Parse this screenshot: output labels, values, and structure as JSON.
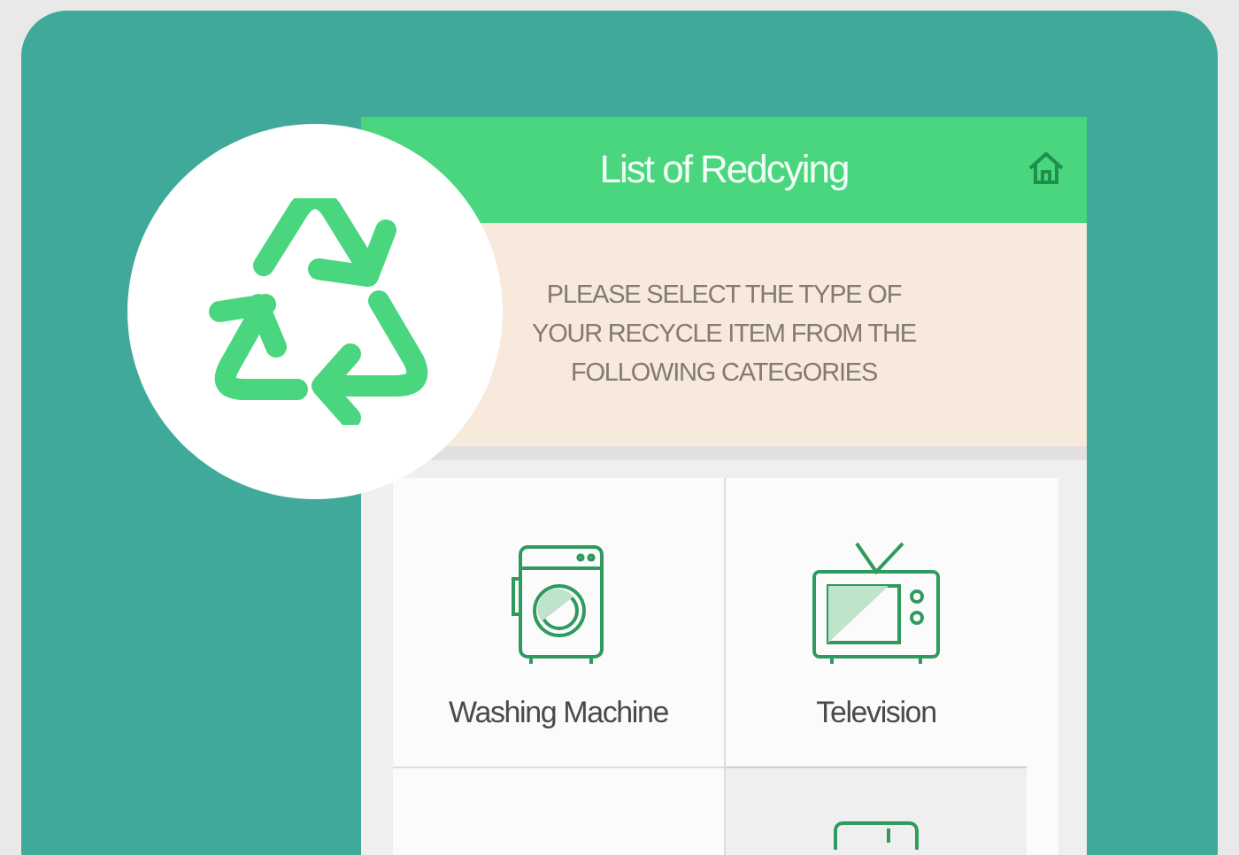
{
  "header": {
    "title": "List of Redcying"
  },
  "instructions": "PLEASE SELECT THE TYPE OF YOUR RECYCLE ITEM FROM THE FOLLOWING CATEGORIES",
  "categories": [
    {
      "kind": "washing_machine",
      "label": "Washing Machine"
    },
    {
      "kind": "television",
      "label": "Television"
    },
    {
      "kind": "empty"
    },
    {
      "kind": "partial_device"
    }
  ]
}
